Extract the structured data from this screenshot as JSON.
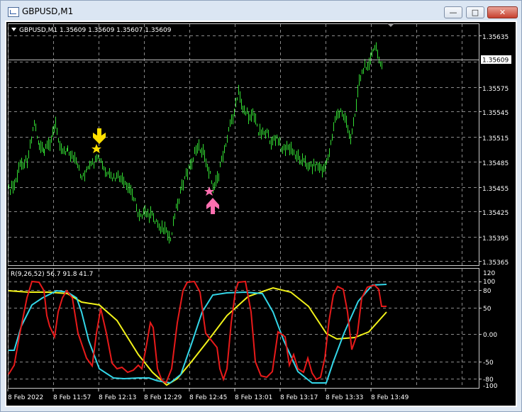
{
  "window": {
    "title": "GBPUSD,M1",
    "minimize": "—",
    "maximize": "□",
    "close": "✕"
  },
  "chart": {
    "header": "GBPUSD,M1  1.35609 1.35609 1.35607 1.35609",
    "current_price": "1.35609",
    "price_ticks": [
      "1.35635",
      "1.35575",
      "1.35545",
      "1.35515",
      "1.35485",
      "1.35455",
      "1.35425",
      "1.35395",
      "1.35365"
    ],
    "up_color": "#33dd33"
  },
  "indicator": {
    "label": "R(9,26,52) 56.7 91.8 41.7",
    "ticks": [
      "120",
      "100",
      "80",
      "50",
      "0.00",
      "-50",
      "-80",
      "-100"
    ],
    "colors": {
      "fast": "#e81a1a",
      "mid": "#33d6e8",
      "slow": "#f2f21a"
    }
  },
  "time_ticks": [
    "8 Feb 2022",
    "8 Feb 11:57",
    "8 Feb 12:13",
    "8 Feb 12:29",
    "8 Feb 12:45",
    "8 Feb 13:01",
    "8 Feb 13:17",
    "8 Feb 13:33",
    "8 Feb 13:49"
  ],
  "markers": {
    "sell": "yellow-down-arrow",
    "buy": "pink-up-arrow"
  }
}
